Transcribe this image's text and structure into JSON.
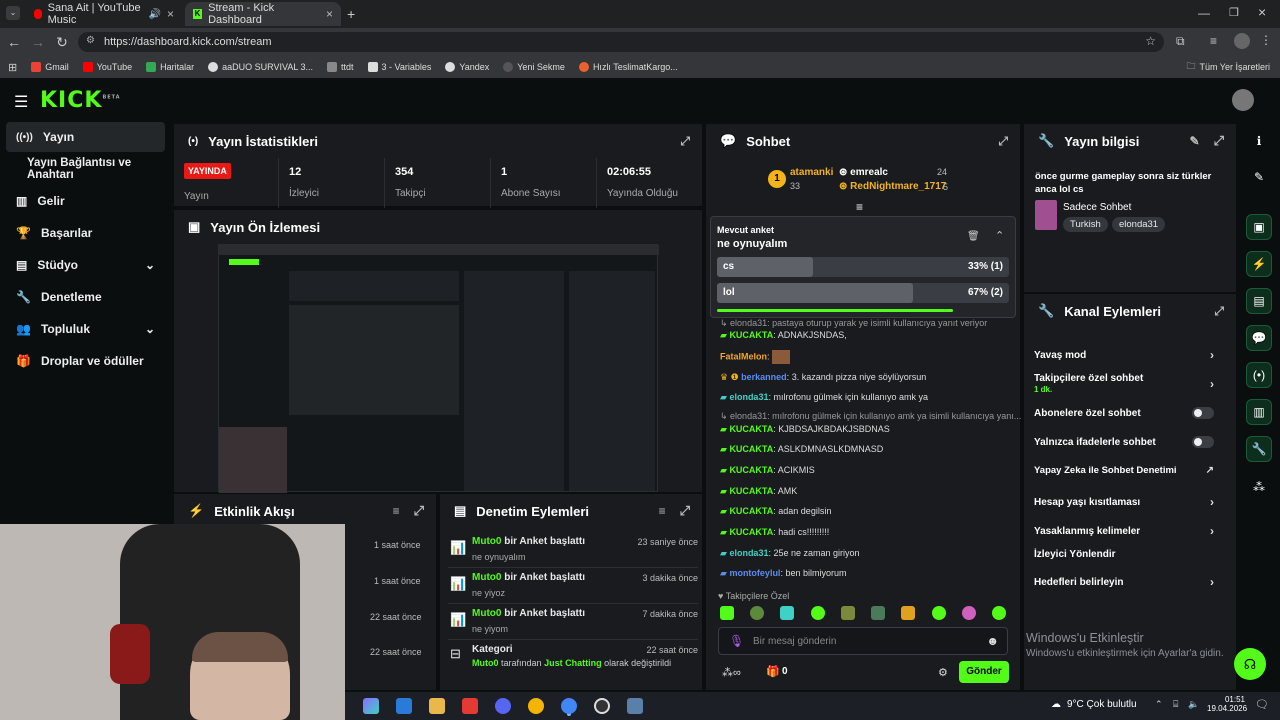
{
  "browser": {
    "tabs": [
      {
        "title": "Sana Ait | YouTube Music"
      },
      {
        "title": "Stream - Kick Dashboard"
      }
    ],
    "url": "https://dashboard.kick.com/stream",
    "bookmarks": [
      "Gmail",
      "YouTube",
      "Haritalar",
      "aaDUO SURVIVAL 3...",
      "ttdt",
      "3 - Variables",
      "Yandex",
      "Yeni Sekme",
      "Hızlı TeslimatKargo..."
    ],
    "all_bookmarks": "Tüm Yer İşaretleri"
  },
  "app": {
    "logo": "KICK",
    "logo_sup": "BETA"
  },
  "sidebar": {
    "items": [
      {
        "label": "Yayın"
      },
      {
        "label": "Yayın Bağlantısı ve Anahtarı"
      },
      {
        "label": "Gelir"
      },
      {
        "label": "Başarılar"
      },
      {
        "label": "Stüdyo"
      },
      {
        "label": "Denetleme"
      },
      {
        "label": "Topluluk"
      },
      {
        "label": "Droplar ve ödüller"
      }
    ]
  },
  "stats": {
    "title": "Yayın İstatistikleri",
    "live_badge": "YAYINDA",
    "live_label": "Yayın",
    "cells": [
      {
        "value": "12",
        "label": "İzleyici"
      },
      {
        "value": "354",
        "label": "Takipçi"
      },
      {
        "value": "1",
        "label": "Abone Sayısı"
      },
      {
        "value": "02:06:55",
        "label": "Yayında Olduğu"
      }
    ]
  },
  "preview": {
    "title": "Yayın Ön İzlemesi"
  },
  "activity": {
    "title": "Etkinlik Akışı",
    "times": [
      "1 saat önce",
      "1 saat önce",
      "22 saat önce",
      "22 saat önce"
    ]
  },
  "moderation": {
    "title": "Denetim Eylemleri",
    "rows": [
      {
        "user": "Muto0",
        "action": "bir Anket başlattı",
        "time": "23 saniye önce",
        "detail": "ne oynuyalım"
      },
      {
        "user": "Muto0",
        "action": "bir Anket başlattı",
        "time": "3 dakika önce",
        "detail": "ne yiyoz"
      },
      {
        "user": "Muto0",
        "action": "bir Anket başlattı",
        "time": "7 dakika önce",
        "detail": "ne yiyom"
      },
      {
        "user": "Kategori",
        "action": "",
        "time": "22 saat önce",
        "detail_user": "Muto0",
        "detail_mid": "tarafından",
        "detail_cat": "Just Chatting",
        "detail_end": "olarak değiştirildi"
      }
    ]
  },
  "chat": {
    "title": "Sohbet",
    "leaderboard": [
      {
        "rank": "1",
        "name": "atamanki",
        "value": "33"
      },
      {
        "name": "emrealc",
        "value": "24"
      },
      {
        "name": "RedNightmare_1717",
        "value": "5"
      }
    ],
    "poll": {
      "label": "Mevcut anket",
      "question": "ne oynuyalım",
      "options": [
        {
          "name": "cs",
          "pct_text": "33% (1)",
          "pct": 33
        },
        {
          "name": "lol",
          "pct_text": "67% (2)",
          "pct": 67
        }
      ]
    },
    "messages": [
      {
        "user": "elonda31",
        "text": "pastaya oturup yarak ye isimli kullanıcıya yanıt veriyor",
        "reply": true
      },
      {
        "user": "KUCAKTA",
        "text": "ADNAKJSNDAS,"
      },
      {
        "user": "FatalMelon",
        "text": ""
      },
      {
        "user": "berkanned",
        "text": "3. kazandı pizza niye söylüyorsun"
      },
      {
        "user": "elonda31",
        "text": "mılrofonu gülmek için kullanıyo amk ya"
      },
      {
        "user": "elonda31",
        "text": "mılrofonu gülmek için kullanıyo amk ya isimli kullanıcıya yanı...",
        "reply": true
      },
      {
        "user": "KUCAKTA",
        "text": "KJBDSAJKBDAKJSBDNAS"
      },
      {
        "user": "KUCAKTA",
        "text": "ASLKDMNASLKDMNASD"
      },
      {
        "user": "KUCAKTA",
        "text": "ACIKMIS"
      },
      {
        "user": "KUCAKTA",
        "text": "AMK"
      },
      {
        "user": "KUCAKTA",
        "text": "adan degilsin"
      },
      {
        "user": "KUCAKTA",
        "text": "hadi cs!!!!!!!!!"
      },
      {
        "user": "elonda31",
        "text": "25e ne zaman giriyon"
      },
      {
        "user": "montofeylul",
        "text": "ben bilmiyorum"
      }
    ],
    "followers_only": "Takipçilere Özel",
    "input_placeholder": "Bir mesaj gönderin",
    "points": "0",
    "send": "Gönder"
  },
  "stream_info": {
    "title": "Yayın bilgisi",
    "stream_title": "önce gurme gameplay sonra siz türkler anca lol cs",
    "category": "Sadece Sohbet",
    "tags": [
      "Turkish",
      "elonda31"
    ]
  },
  "channel_actions": {
    "title": "Kanal Eylemleri",
    "items": [
      {
        "label": "Yavaş mod",
        "kind": "arrow"
      },
      {
        "label": "Takipçilere özel sohbet",
        "sub": "1 dk.",
        "kind": "arrow"
      },
      {
        "label": "Abonelere özel sohbet",
        "kind": "toggle"
      },
      {
        "label": "Yalnızca ifadelerle sohbet",
        "kind": "toggle"
      },
      {
        "label": "Yapay Zeka ile Sohbet Denetimi",
        "kind": "ext"
      },
      {
        "label": "Hesap yaşı kısıtlaması",
        "kind": "arrow"
      },
      {
        "label": "Yasaklanmış kelimeler",
        "kind": "arrow"
      },
      {
        "label": "İzleyici Yönlendir",
        "kind": "none"
      },
      {
        "label": "Hedefleri belirleyin",
        "kind": "arrow"
      }
    ]
  },
  "windows_activation": {
    "title": "Windows'u Etkinleştir",
    "sub": "Windows'u etkinleştirmek için Ayarlar'a gidin."
  },
  "taskbar": {
    "weather": "9°C  Çok bulutlu",
    "time": "01:51",
    "date": "19.04.2026"
  },
  "colors": {
    "accent": "#53fc18",
    "panel": "#191b1f",
    "live": "#e91916"
  }
}
